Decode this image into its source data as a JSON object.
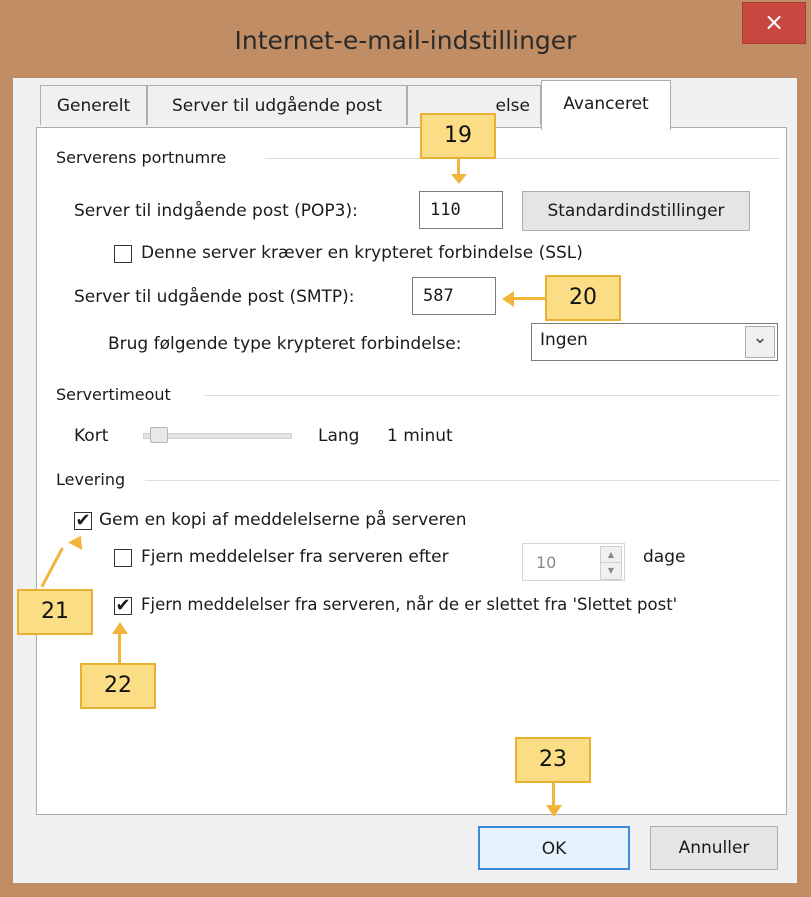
{
  "window": {
    "title": "Internet-e-mail-indstillinger",
    "close_glyph": "×"
  },
  "tabs": [
    {
      "label": "Generelt"
    },
    {
      "label": "Server til udgående post"
    },
    {
      "label": "Forbindelse"
    },
    {
      "label": "Avanceret"
    }
  ],
  "tab_visible_suffix": "else",
  "ports": {
    "group_label": "Serverens portnumre",
    "incoming_label": "Server til indgående post (POP3):",
    "incoming_value": "110",
    "defaults_button": "Standardindstillinger",
    "ssl_label": "Denne server kræver en krypteret forbindelse (SSL)",
    "ssl_checked": false,
    "outgoing_label": "Server til udgående post (SMTP):",
    "outgoing_value": "587",
    "encryption_label": "Brug følgende type krypteret forbindelse:",
    "encryption_value": "Ingen"
  },
  "timeout": {
    "group_label": "Servertimeout",
    "short_label": "Kort",
    "long_label": "Lang",
    "value_label": "1 minut",
    "slider_fraction": 0.1
  },
  "delivery": {
    "group_label": "Levering",
    "keep_copy_label": "Gem en kopi af meddelelserne på serveren",
    "keep_copy_checked": true,
    "remove_after_label": "Fjern meddelelser fra serveren efter",
    "remove_after_checked": false,
    "days_value": "10",
    "days_unit": "dage",
    "remove_deleted_label": "Fjern meddelelser fra serveren, når de er slettet fra 'Slettet post'",
    "remove_deleted_checked": true
  },
  "buttons": {
    "ok": "OK",
    "cancel": "Annuller"
  },
  "callouts": [
    "19",
    "20",
    "21",
    "22",
    "23"
  ],
  "glyphs": {
    "check": "✔",
    "dropdown": "⌄",
    "spin_up": "▲",
    "spin_down": "▼"
  }
}
